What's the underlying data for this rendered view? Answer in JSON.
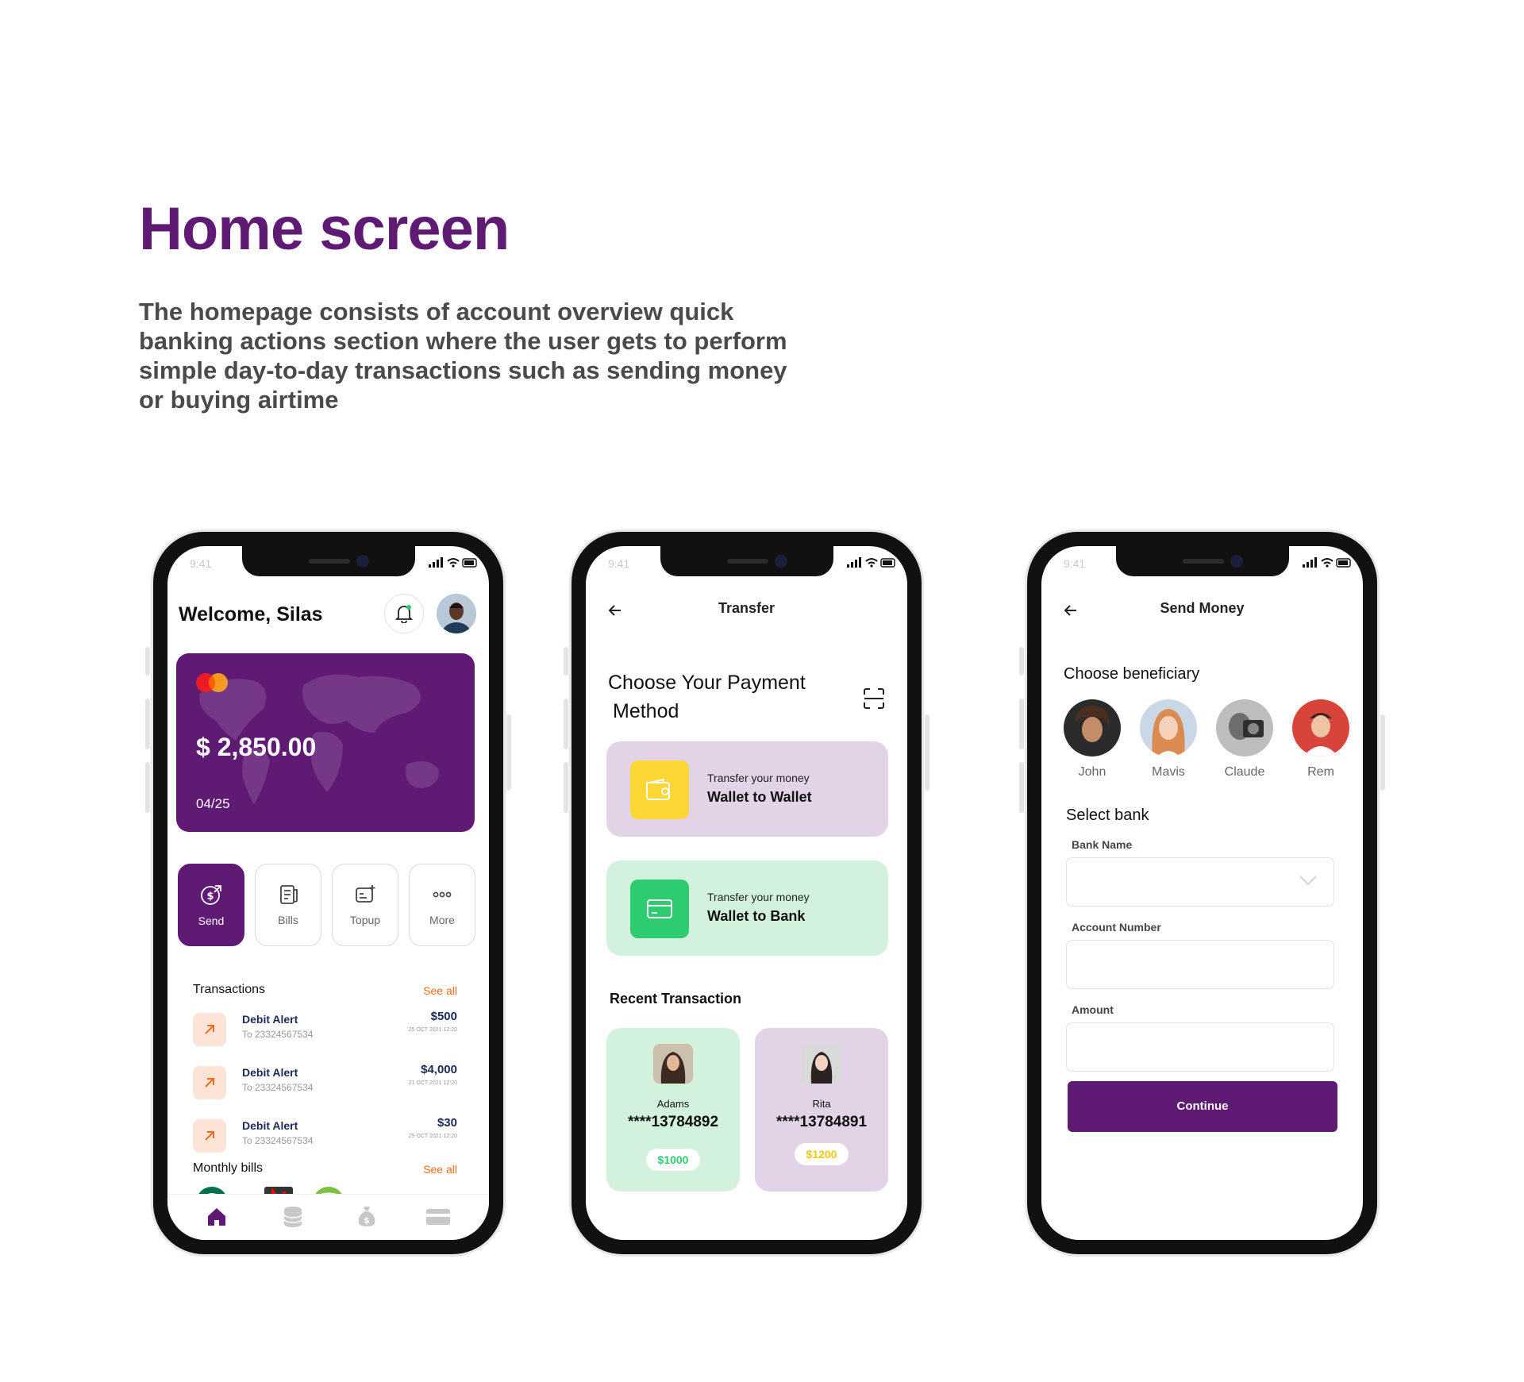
{
  "page": {
    "title": "Home screen",
    "description": "The homepage consists of account overview quick banking actions section where the user gets to perform simple day-to-day transactions such as sending money or buying airtime"
  },
  "status_bar": {
    "time": "9:41"
  },
  "home": {
    "welcome": "Welcome, Silas",
    "card": {
      "balance": "$ 2,850.00",
      "expiry": "04/25",
      "brand_icon": "mastercard-logo"
    },
    "quick_actions": [
      {
        "label": "Send",
        "icon": "send-money-icon"
      },
      {
        "label": "Bills",
        "icon": "bills-icon"
      },
      {
        "label": "Topup",
        "icon": "topup-icon"
      },
      {
        "label": "More",
        "icon": "more-icon"
      }
    ],
    "transactions": {
      "title": "Transactions",
      "see_all": "See all",
      "items": [
        {
          "title": "Debit Alert",
          "sub": "To 23324567534",
          "amount": "$500",
          "date": "25 OCT 2021 12:20"
        },
        {
          "title": "Debit Alert",
          "sub": "To 23324567534",
          "amount": "$4,000",
          "date": "21 OCT 2021 12:20"
        },
        {
          "title": "Debit Alert",
          "sub": "To 23324567534",
          "amount": "$30",
          "date": "25 OCT 2021 12:20"
        }
      ]
    },
    "monthly_bills": {
      "title": "Monthly bills",
      "see_all": "See all",
      "logos": [
        "starbucks-logo",
        "netflix-logo",
        "spotify-logo"
      ]
    },
    "tabbar": [
      "home-icon",
      "database-icon",
      "money-bag-icon",
      "wallet-icon"
    ]
  },
  "transfer": {
    "title": "Transfer",
    "heading_line1": "Choose Your Payment",
    "heading_line2": "Method",
    "methods": [
      {
        "small": "Transfer your money",
        "big": "Wallet to Wallet",
        "bg": "#e2d3e6",
        "icon_bg": "#fdd835"
      },
      {
        "small": "Transfer your money",
        "big": "Wallet to Bank",
        "bg": "#d3f2de",
        "icon_bg": "#2ecc71"
      }
    ],
    "recent_title": "Recent Transaction",
    "recent": [
      {
        "name": "Adams",
        "number": "****13784892",
        "amount": "$1000",
        "bg": "#d3f2de",
        "pill_color": "#2ecc71"
      },
      {
        "name": "Rita",
        "number": "****13784891",
        "amount": "$1200",
        "bg": "#e2d3e6",
        "pill_color": "#f2c80f"
      }
    ]
  },
  "send_money": {
    "title": "Send Money",
    "beneficiary_title": "Choose beneficiary",
    "beneficiaries": [
      "John",
      "Mavis",
      "Claude",
      "Rem"
    ],
    "select_bank": "Select bank",
    "fields": [
      {
        "label": "Bank Name",
        "value": ""
      },
      {
        "label": "Account Number",
        "value": ""
      },
      {
        "label": "Amount",
        "value": ""
      }
    ],
    "continue": "Continue"
  }
}
